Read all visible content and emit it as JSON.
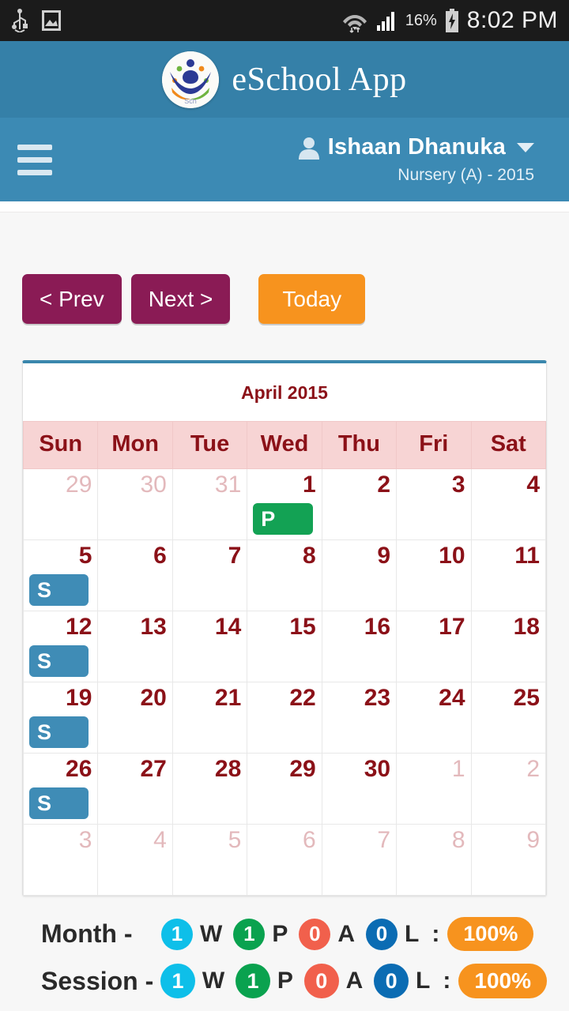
{
  "status_bar": {
    "icons_left": [
      "usb-icon",
      "screenshot-icon"
    ],
    "icons_right": [
      "wifi-icon",
      "signal-icon"
    ],
    "battery_percent": "16%",
    "battery_state": "charging",
    "clock": "8:02 PM"
  },
  "app_header": {
    "title": "eSchool App",
    "logo": "eschool-logo"
  },
  "nav": {
    "menu_icon": "hamburger-menu-icon",
    "user_icon": "person-icon",
    "user_name": "Ishaan Dhanuka",
    "caret_icon": "chevron-down-icon",
    "class_label": "Nursery (A) - 2015"
  },
  "toolbar": {
    "prev_label": "< Prev",
    "next_label": "Next >",
    "today_label": "Today"
  },
  "calendar": {
    "title": "April 2015",
    "weekdays": [
      "Sun",
      "Mon",
      "Tue",
      "Wed",
      "Thu",
      "Fri",
      "Sat"
    ],
    "weeks": [
      [
        {
          "day": "29",
          "other": true,
          "badge": ""
        },
        {
          "day": "30",
          "other": true,
          "badge": ""
        },
        {
          "day": "31",
          "other": true,
          "badge": ""
        },
        {
          "day": "1",
          "other": false,
          "badge": "P"
        },
        {
          "day": "2",
          "other": false,
          "badge": ""
        },
        {
          "day": "3",
          "other": false,
          "badge": ""
        },
        {
          "day": "4",
          "other": false,
          "badge": ""
        }
      ],
      [
        {
          "day": "5",
          "other": false,
          "badge": "S"
        },
        {
          "day": "6",
          "other": false,
          "badge": ""
        },
        {
          "day": "7",
          "other": false,
          "badge": ""
        },
        {
          "day": "8",
          "other": false,
          "badge": ""
        },
        {
          "day": "9",
          "other": false,
          "badge": ""
        },
        {
          "day": "10",
          "other": false,
          "badge": ""
        },
        {
          "day": "11",
          "other": false,
          "badge": ""
        }
      ],
      [
        {
          "day": "12",
          "other": false,
          "badge": "S"
        },
        {
          "day": "13",
          "other": false,
          "badge": ""
        },
        {
          "day": "14",
          "other": false,
          "badge": ""
        },
        {
          "day": "15",
          "other": false,
          "badge": ""
        },
        {
          "day": "16",
          "other": false,
          "badge": ""
        },
        {
          "day": "17",
          "other": false,
          "badge": ""
        },
        {
          "day": "18",
          "other": false,
          "badge": ""
        }
      ],
      [
        {
          "day": "19",
          "other": false,
          "badge": "S"
        },
        {
          "day": "20",
          "other": false,
          "badge": ""
        },
        {
          "day": "21",
          "other": false,
          "badge": ""
        },
        {
          "day": "22",
          "other": false,
          "badge": ""
        },
        {
          "day": "23",
          "other": false,
          "badge": ""
        },
        {
          "day": "24",
          "other": false,
          "badge": ""
        },
        {
          "day": "25",
          "other": false,
          "badge": ""
        }
      ],
      [
        {
          "day": "26",
          "other": false,
          "badge": "S"
        },
        {
          "day": "27",
          "other": false,
          "badge": ""
        },
        {
          "day": "28",
          "other": false,
          "badge": ""
        },
        {
          "day": "29",
          "other": false,
          "badge": ""
        },
        {
          "day": "30",
          "other": false,
          "badge": ""
        },
        {
          "day": "1",
          "other": true,
          "badge": ""
        },
        {
          "day": "2",
          "other": true,
          "badge": ""
        }
      ],
      [
        {
          "day": "3",
          "other": true,
          "badge": ""
        },
        {
          "day": "4",
          "other": true,
          "badge": ""
        },
        {
          "day": "5",
          "other": true,
          "badge": ""
        },
        {
          "day": "6",
          "other": true,
          "badge": ""
        },
        {
          "day": "7",
          "other": true,
          "badge": ""
        },
        {
          "day": "8",
          "other": true,
          "badge": ""
        },
        {
          "day": "9",
          "other": true,
          "badge": ""
        }
      ]
    ]
  },
  "summary": {
    "month": {
      "label": "Month -",
      "counts": [
        {
          "value": "1",
          "code": "W",
          "color": "#0ebfe9"
        },
        {
          "value": "1",
          "code": "P",
          "color": "#0aa24f"
        },
        {
          "value": "0",
          "code": "A",
          "color": "#f1604c"
        },
        {
          "value": "0",
          "code": "L",
          "color": "#0b6cb3"
        }
      ],
      "separator": ":",
      "percent": "100%"
    },
    "session": {
      "label": "Session -",
      "counts": [
        {
          "value": "1",
          "code": "W",
          "color": "#0ebfe9"
        },
        {
          "value": "1",
          "code": "P",
          "color": "#0aa24f"
        },
        {
          "value": "0",
          "code": "A",
          "color": "#f1604c"
        },
        {
          "value": "0",
          "code": "L",
          "color": "#0b6cb3"
        }
      ],
      "separator": ":",
      "percent": "100%"
    }
  },
  "colors": {
    "header_blue": "#3580a8",
    "nav_blue": "#3c8ab4",
    "maroon": "#8a1b55",
    "orange": "#f7931e",
    "present_green": "#13a254",
    "sunday_blue": "#3f8cb6",
    "date_red": "#8b1118",
    "weekday_pink": "#f7d4d4"
  }
}
